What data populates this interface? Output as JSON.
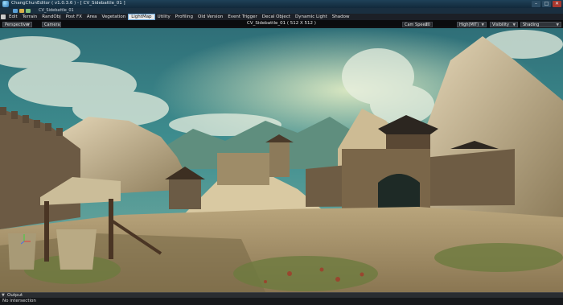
{
  "window": {
    "app_title": "ChangChunEditor ( v1.0.3.6 ) - [ CV_Sidebattle_01 ]",
    "document_title": "CV_Sidebattle_01",
    "minimize": "–",
    "maximize": "□",
    "close": "✕"
  },
  "menu": {
    "items": [
      "Edit",
      "Terrain",
      "RandObj",
      "Post FX",
      "Area",
      "Vegetation",
      "LightMap",
      "Utility",
      "Profiling",
      "Old Version",
      "Event Trigger",
      "Decal Object",
      "Dynamic Light",
      "Shadow"
    ],
    "active": "LightMap"
  },
  "viewport": {
    "title": "CV_Sidebattle_01 ( 512 X 512 )",
    "projection": "Perspective",
    "camera_button": "Camera",
    "cam_speed_label": "Cam Speed",
    "cam_speed_value": "20",
    "quality": "High(MIT)",
    "visibility": "Visibility",
    "shading": "Shading"
  },
  "output": {
    "title": "Output",
    "message": "No intersection"
  },
  "colors": {
    "titlebar": "#1f4158",
    "active_menu": "#e8e8e8",
    "sky_teal": "#3f8f90"
  },
  "icons": [
    "app-logo-icon",
    "quick-new-icon",
    "quick-open-icon",
    "quick-save-icon",
    "dropdown-arrow-icon",
    "axis-gizmo-icon"
  ]
}
